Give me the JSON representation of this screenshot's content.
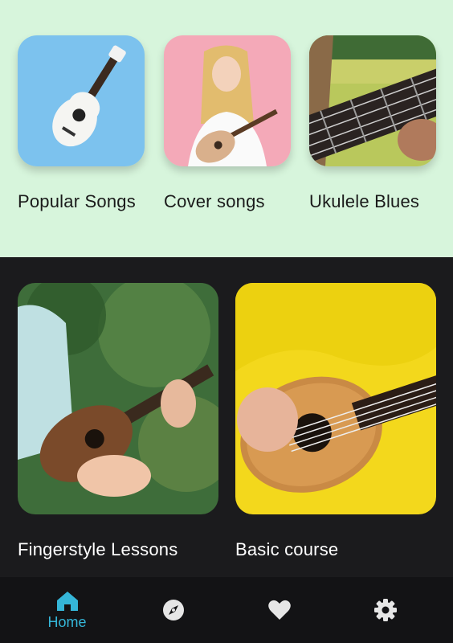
{
  "featured": [
    {
      "label": "Popular Songs",
      "image": "white-ukulele-on-blue-background"
    },
    {
      "label": "Cover songs",
      "image": "blonde-woman-playing-ukulele-pink-background"
    },
    {
      "label": "Ukulele Blues",
      "image": "hands-on-ukulele-neck-outdoors"
    }
  ],
  "courses": [
    {
      "label": "Fingerstyle Lessons",
      "image": "person-playing-ukulele-in-forest"
    },
    {
      "label": "Basic course",
      "image": "hands-playing-ukulele-yellow-shirt"
    }
  ],
  "nav": {
    "items": [
      {
        "icon": "home-icon",
        "label": "Home",
        "active": true
      },
      {
        "icon": "compass-icon",
        "label": "",
        "active": false
      },
      {
        "icon": "heart-icon",
        "label": "",
        "active": false
      },
      {
        "icon": "gear-icon",
        "label": "",
        "active": false
      }
    ],
    "active_color": "#35b6d8",
    "inactive_color": "#e6e6e6"
  },
  "colors": {
    "top_background": "#d7f5dc",
    "bottom_background": "#1b1b1d",
    "nav_background": "#131315"
  }
}
